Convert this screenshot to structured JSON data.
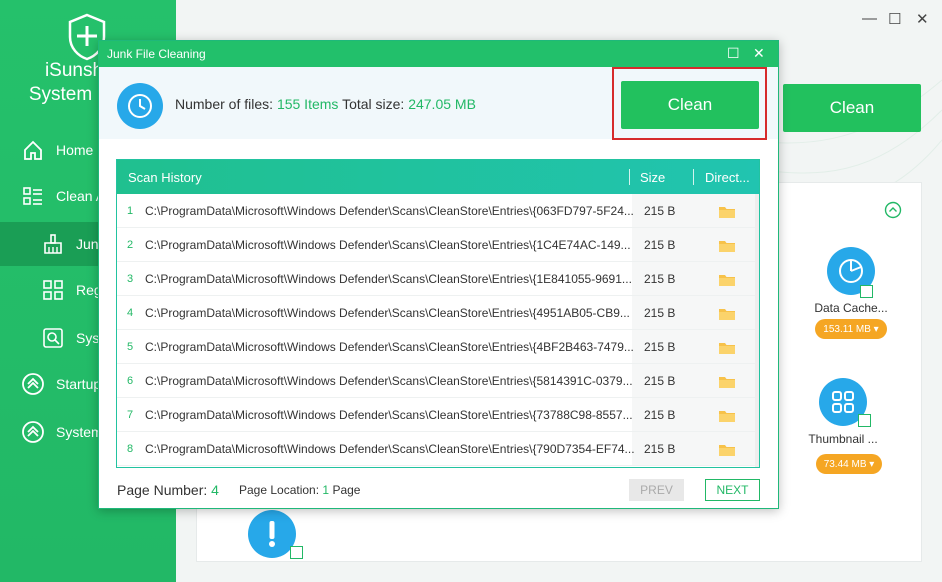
{
  "app": {
    "name_line1": "iSunsh",
    "name_line2": "System C"
  },
  "sidebar": {
    "items": [
      {
        "label": "Home",
        "icon": "home-icon"
      },
      {
        "label": "Clean A",
        "icon": "clean-list-icon"
      },
      {
        "label": "Junk",
        "icon": "broom-icon"
      },
      {
        "label": "Reg",
        "icon": "registry-icon"
      },
      {
        "label": "Sys",
        "icon": "system-search-icon"
      },
      {
        "label": "Startup",
        "icon": "startup-icon"
      },
      {
        "label": "System",
        "icon": "system-icon"
      }
    ]
  },
  "window": {
    "minimize": "—",
    "maximize": "☐",
    "close": "✕"
  },
  "main": {
    "clean_label": "Clean",
    "categories": [
      {
        "label": "Data Cache...",
        "size": "153.11 MB"
      },
      {
        "label": "Thumbnail ...",
        "size": "73.44 MB"
      }
    ]
  },
  "dialog": {
    "title": "Junk File Cleaning",
    "files_label": "Number of files:",
    "files_value": "155 Items",
    "size_label": "Total size:",
    "size_value": "247.05 MB",
    "clean_label": "Clean",
    "table": {
      "headers": {
        "history": "Scan History",
        "size": "Size",
        "directory": "Direct..."
      },
      "rows": [
        {
          "num": "1",
          "path": "C:\\ProgramData\\Microsoft\\Windows Defender\\Scans\\CleanStore\\Entries\\{063FD797-5F24...",
          "size": "215 B"
        },
        {
          "num": "2",
          "path": "C:\\ProgramData\\Microsoft\\Windows Defender\\Scans\\CleanStore\\Entries\\{1C4E74AC-149...",
          "size": "215 B"
        },
        {
          "num": "3",
          "path": "C:\\ProgramData\\Microsoft\\Windows Defender\\Scans\\CleanStore\\Entries\\{1E841055-9691...",
          "size": "215 B"
        },
        {
          "num": "4",
          "path": "C:\\ProgramData\\Microsoft\\Windows Defender\\Scans\\CleanStore\\Entries\\{4951AB05-CB9...",
          "size": "215 B"
        },
        {
          "num": "5",
          "path": "C:\\ProgramData\\Microsoft\\Windows Defender\\Scans\\CleanStore\\Entries\\{4BF2B463-7479...",
          "size": "215 B"
        },
        {
          "num": "6",
          "path": "C:\\ProgramData\\Microsoft\\Windows Defender\\Scans\\CleanStore\\Entries\\{5814391C-0379...",
          "size": "215 B"
        },
        {
          "num": "7",
          "path": "C:\\ProgramData\\Microsoft\\Windows Defender\\Scans\\CleanStore\\Entries\\{73788C98-8557...",
          "size": "215 B"
        },
        {
          "num": "8",
          "path": "C:\\ProgramData\\Microsoft\\Windows Defender\\Scans\\CleanStore\\Entries\\{790D7354-EF74...",
          "size": "215 B"
        }
      ]
    },
    "pager": {
      "page_number_label": "Page Number:",
      "page_number_value": "4",
      "page_location_label": "Page Location:",
      "page_location_value": "1",
      "page_location_suffix": "Page",
      "prev": "PREV",
      "next": "NEXT"
    }
  },
  "colors": {
    "accent": "#22c15e",
    "info": "#27a8e9",
    "warn": "#f5a623",
    "highlight": "#d62b2b"
  }
}
